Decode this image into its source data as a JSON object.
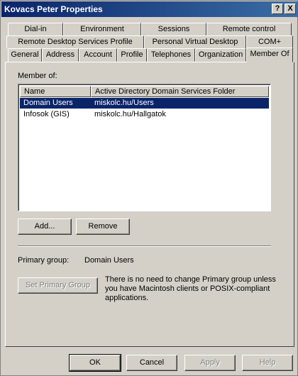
{
  "window": {
    "title": "Kovacs Peter Properties",
    "help_glyph": "?",
    "close_glyph": "X"
  },
  "tabs": {
    "row1": [
      "Dial-in",
      "Environment",
      "Sessions",
      "Remote control"
    ],
    "row2": [
      "Remote Desktop Services Profile",
      "Personal Virtual Desktop",
      "COM+"
    ],
    "row3": [
      "General",
      "Address",
      "Account",
      "Profile",
      "Telephones",
      "Organization",
      "Member Of"
    ],
    "active": "Member Of"
  },
  "member_of": {
    "label": "Member of:",
    "columns": [
      "Name",
      "Active Directory Domain Services Folder"
    ],
    "rows": [
      {
        "name": "Domain Users",
        "folder": "miskolc.hu/Users",
        "selected": true
      },
      {
        "name": "Infosok (GIS)",
        "folder": "miskolc.hu/Hallgatok",
        "selected": false
      }
    ]
  },
  "buttons": {
    "add": "Add...",
    "remove": "Remove",
    "set_primary": "Set Primary Group",
    "ok": "OK",
    "cancel": "Cancel",
    "apply": "Apply",
    "help": "Help"
  },
  "primary_group": {
    "label": "Primary group:",
    "value": "Domain Users",
    "note": "There is no need to change Primary group unless you have Macintosh clients or POSIX-compliant applications."
  },
  "colors": {
    "selection": "#0a246a",
    "face": "#d4d0c8"
  }
}
